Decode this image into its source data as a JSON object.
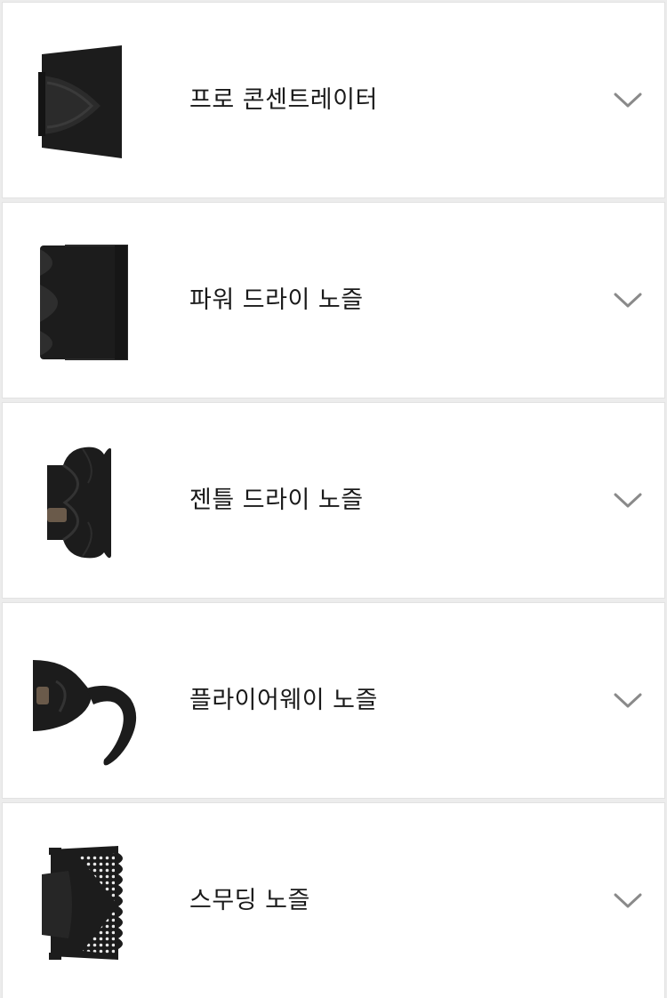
{
  "accessories": [
    {
      "label": "프로 콘센트레이터",
      "icon": "pro-concentrator-icon"
    },
    {
      "label": "파워 드라이 노즐",
      "icon": "power-dry-nozzle-icon"
    },
    {
      "label": "젠틀 드라이 노즐",
      "icon": "gentle-dry-nozzle-icon"
    },
    {
      "label": "플라이어웨이 노즐",
      "icon": "flyaway-nozzle-icon"
    },
    {
      "label": "스무딩 노즐",
      "icon": "smoothing-nozzle-icon"
    }
  ],
  "colors": {
    "background": "#ececec",
    "row": "#ffffff",
    "text": "#1a1a1a",
    "chevron": "#8a8a8a",
    "product": "#1c1c1c"
  }
}
